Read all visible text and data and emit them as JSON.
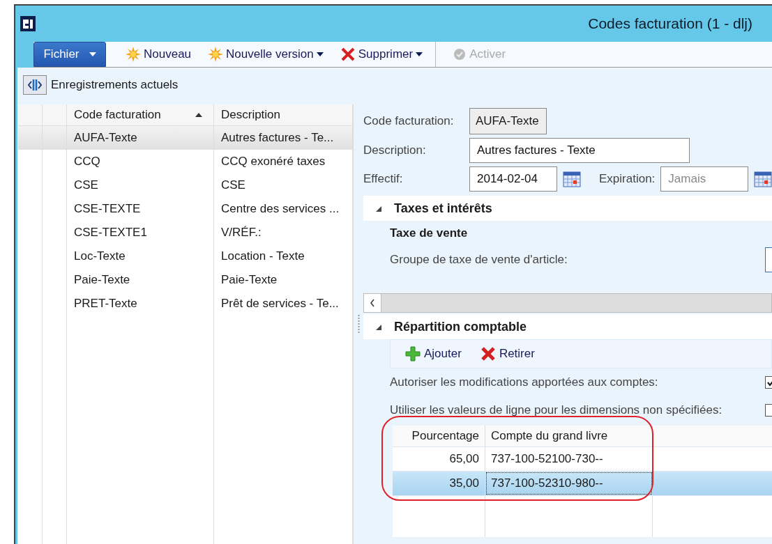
{
  "window": {
    "title": "Codes facturation (1 - dlj)"
  },
  "toolbar": {
    "file_menu": "Fichier",
    "buttons": [
      {
        "label": "Nouveau",
        "kind": "new",
        "dropdown": false,
        "disabled": false
      },
      {
        "label": "Nouvelle version",
        "kind": "new",
        "dropdown": true,
        "disabled": false
      },
      {
        "label": "Supprimer",
        "kind": "delete",
        "dropdown": true,
        "disabled": false
      },
      {
        "label": "Activer",
        "kind": "activate",
        "dropdown": false,
        "disabled": true
      }
    ]
  },
  "nav": {
    "label": "Enregistrements actuels"
  },
  "list": {
    "columns": [
      {
        "label": "Code facturation",
        "sorted": true
      },
      {
        "label": "Description",
        "sorted": false
      }
    ],
    "rows": [
      {
        "code": "AUFA-Texte",
        "description": "Autres factures - Te...",
        "selected": true
      },
      {
        "code": "CCQ",
        "description": "CCQ exonéré taxes",
        "selected": false
      },
      {
        "code": "CSE",
        "description": "CSE",
        "selected": false
      },
      {
        "code": "CSE-TEXTE",
        "description": "Centre des services ...",
        "selected": false
      },
      {
        "code": "CSE-TEXTE1",
        "description": "V/RÉF.:",
        "selected": false
      },
      {
        "code": "Loc-Texte",
        "description": "Location - Texte",
        "selected": false
      },
      {
        "code": "Paie-Texte",
        "description": "Paie-Texte",
        "selected": false
      },
      {
        "code": "PRET-Texte",
        "description": "Prêt de services - Te...",
        "selected": false
      }
    ]
  },
  "form": {
    "code": {
      "label": "Code facturation:",
      "value": "AUFA-Texte"
    },
    "description": {
      "label": "Description:",
      "value": "Autres factures - Texte"
    },
    "effective": {
      "label": "Effectif:",
      "value": "2014-02-04"
    },
    "expiration": {
      "label": "Expiration:",
      "placeholder": "Jamais"
    }
  },
  "taxes": {
    "title": "Taxes et intérêts",
    "expanded": true,
    "group": "Taxe de vente",
    "field_label": "Groupe de taxe de vente d'article:"
  },
  "distribution": {
    "title": "Répartition comptable",
    "expanded": true,
    "actions": [
      {
        "label": "Ajouter",
        "kind": "add"
      },
      {
        "label": "Retirer",
        "kind": "remove"
      }
    ],
    "options": [
      {
        "label": "Autoriser les modifications apportées aux comptes:",
        "checked": true
      },
      {
        "label": "Utiliser les valeurs de ligne pour les dimensions non spécifiées:",
        "checked": false
      }
    ],
    "columns": [
      "Pourcentage",
      "Compte du grand livre"
    ],
    "rows": [
      {
        "percent": "65,00",
        "account": "737-100-52100-730--",
        "selected": false
      },
      {
        "percent": "35,00",
        "account": "737-100-52310-980--",
        "selected": true
      }
    ]
  }
}
